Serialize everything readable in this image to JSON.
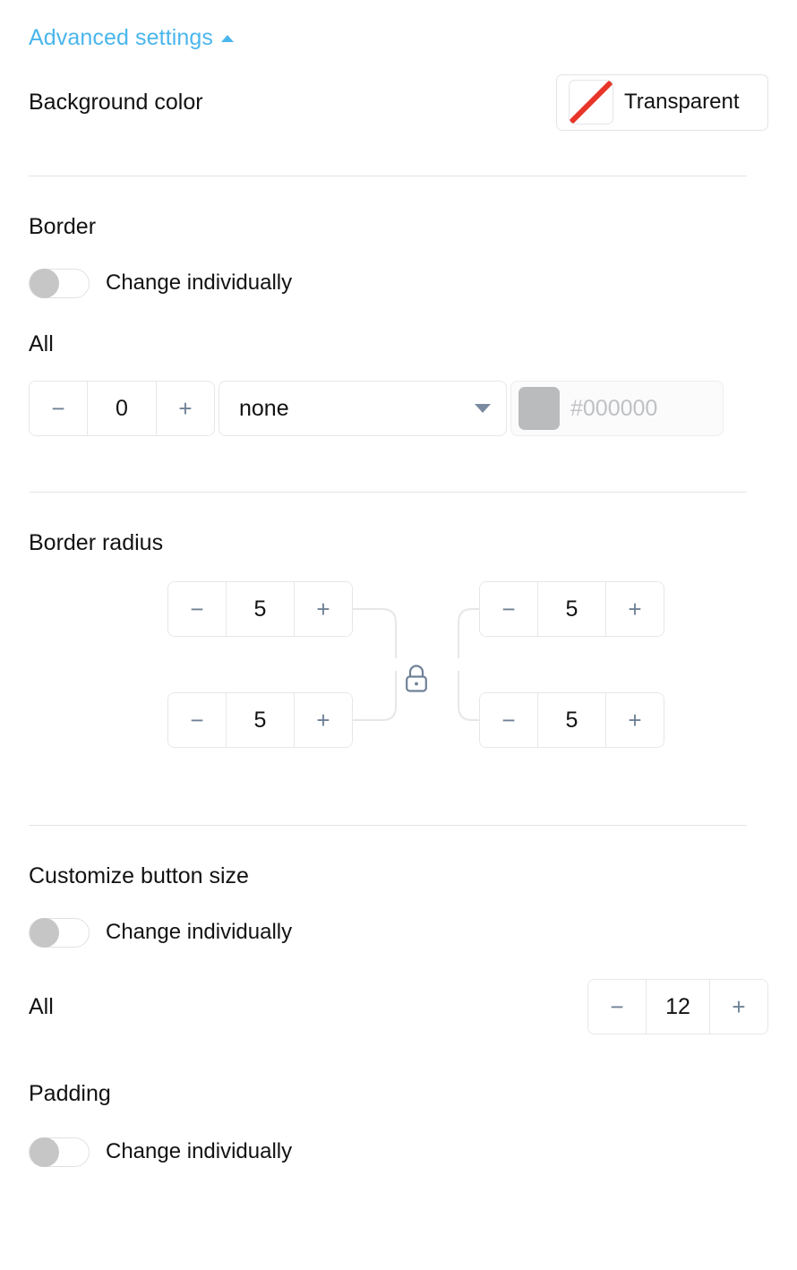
{
  "advanced": {
    "label": "Advanced settings",
    "caret_icon": "caret-up-icon",
    "expanded": "true"
  },
  "background_color": {
    "label": "Background color",
    "chip_label": "Transparent",
    "swatch_icon": "transparent-swatch-icon",
    "swatch_stripe_color": "#e8352a"
  },
  "border": {
    "title": "Border",
    "toggle_label": "Change individually",
    "toggle_state": "off",
    "all_label": "All",
    "width_stepper": {
      "minus": "−",
      "value": "0",
      "plus": "+"
    },
    "style_select": {
      "value": "none",
      "caret_icon": "caret-down-icon"
    },
    "color_field": {
      "placeholder": "#000000",
      "swatch_color": "#b9bbbd",
      "disabled": "true"
    }
  },
  "border_radius": {
    "title": "Border radius",
    "lock_icon": "lock-closed-icon",
    "corners": [
      {
        "name": "top-left",
        "minus": "−",
        "value": "5",
        "plus": "+"
      },
      {
        "name": "top-right",
        "minus": "−",
        "value": "5",
        "plus": "+"
      },
      {
        "name": "bottom-left",
        "minus": "−",
        "value": "5",
        "plus": "+"
      },
      {
        "name": "bottom-right",
        "minus": "−",
        "value": "5",
        "plus": "+"
      }
    ]
  },
  "customize_button_size": {
    "title": "Customize button size",
    "toggle_label": "Change individually",
    "toggle_state": "off",
    "all_label": "All",
    "stepper": {
      "minus": "−",
      "value": "12",
      "plus": "+"
    }
  },
  "padding": {
    "title": "Padding",
    "toggle_label": "Change individually",
    "toggle_state": "off"
  },
  "colors": {
    "accent": "#4ab6ec",
    "text": "#121212",
    "stepper_icon": "#6f8196",
    "divider": "#e4e5e7",
    "toggle_knob": "#c6c6c6"
  }
}
